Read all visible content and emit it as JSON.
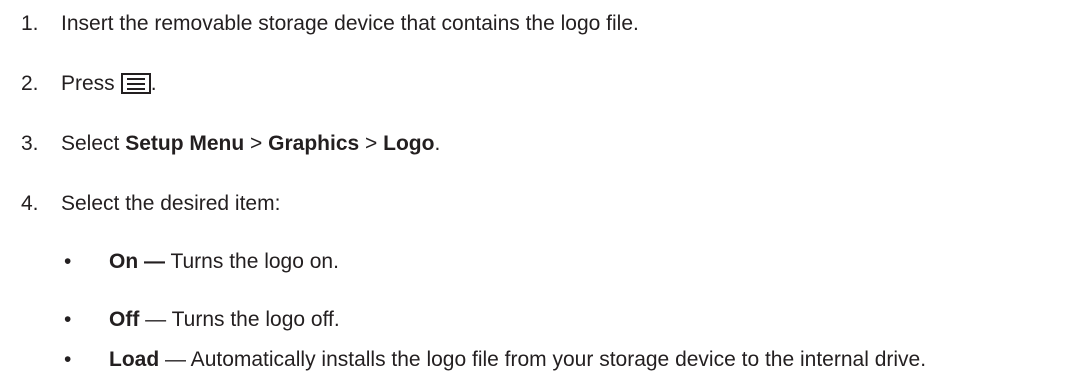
{
  "steps": [
    {
      "num": "1.",
      "text": "Insert the removable storage device that contains the logo file."
    },
    {
      "num": "2.",
      "text": "Press",
      "icon": "menu-icon",
      "after": "."
    },
    {
      "num": "3.",
      "prefix": "Select ",
      "menu1": "Setup Menu",
      "sep1": " > ",
      "menu2": "Graphics",
      "sep2": " > ",
      "menu3": "Logo",
      "suffix": "."
    },
    {
      "num": "4.",
      "text": "Select the desired item:"
    }
  ],
  "bullet_symbol": "•",
  "options": [
    {
      "term": "On —",
      "desc": " Turns the logo on."
    },
    {
      "term": "Off",
      "desc": " — Turns the logo off."
    },
    {
      "term": "Load",
      "desc": " — Automatically installs the logo file from your storage device to the internal drive."
    }
  ]
}
